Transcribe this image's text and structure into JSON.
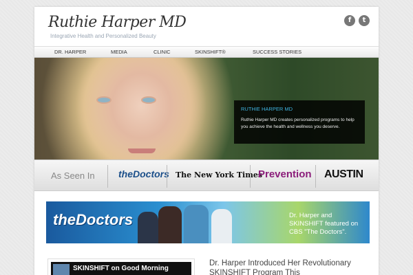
{
  "header": {
    "title": "Ruthie Harper MD",
    "tagline": "Integrative Health and Personalized Beauty",
    "social": [
      {
        "icon": "facebook-icon",
        "glyph": "f"
      },
      {
        "icon": "twitter-icon",
        "glyph": "t"
      }
    ]
  },
  "nav": {
    "items": [
      "DR. HARPER",
      "MEDIA",
      "CLINIC",
      "SKINSHIFT®",
      "SUCCESS STORIES"
    ]
  },
  "hero": {
    "box_title": "RUTHIE HARPER MD",
    "box_text": "Ruthie Harper MD creates personalized programs to help you achieve the health and wellness you deserve."
  },
  "as_seen_in": {
    "label": "As Seen In",
    "outlets": [
      "theDoctors",
      "The New York Times",
      "Prevention",
      "AUSTIN"
    ]
  },
  "banner": {
    "logo": "theDoctors",
    "text": "Dr. Harper and SKINSHIFT featured on CBS \"The Doctors\"."
  },
  "video": {
    "title": "SKINSHIFT on Good Morning"
  },
  "article": {
    "title": "Dr. Harper Introduced Her Revolutionary SKINSHIFT Program This"
  },
  "colors": {
    "accent": "#3fb3e0",
    "nav_bg": "#f2f2f2",
    "hero_box_bg": "#000000",
    "prevention": "#8b1d7a",
    "doctors_blue": "#1b4f8a"
  }
}
